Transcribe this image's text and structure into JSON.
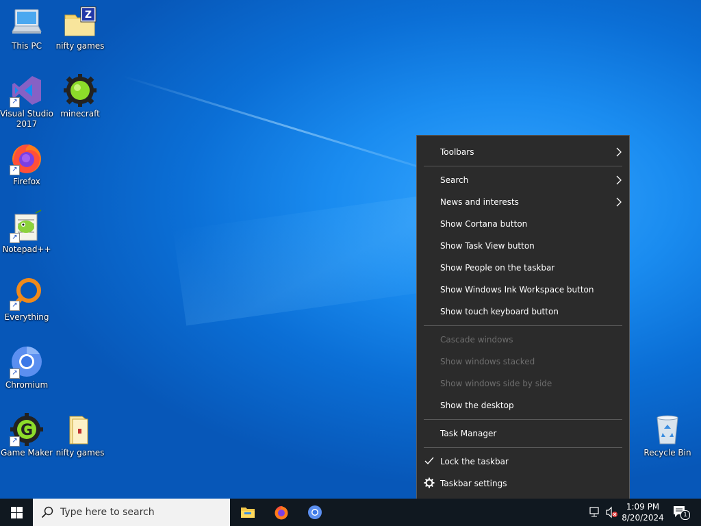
{
  "desktop": {
    "icons": [
      {
        "label": "This PC"
      },
      {
        "label": "nifty games"
      },
      {
        "label": "Visual Studio 2017"
      },
      {
        "label": "minecraft"
      },
      {
        "label": "Firefox"
      },
      {
        "label": "Notepad++"
      },
      {
        "label": "Everything"
      },
      {
        "label": "Chromium"
      },
      {
        "label": "Game Maker"
      },
      {
        "label": "nifty games"
      },
      {
        "label": "Recycle Bin"
      }
    ]
  },
  "context_menu": {
    "items": [
      {
        "label": "Toolbars",
        "submenu": true
      },
      {
        "label": "Search",
        "submenu": true
      },
      {
        "label": "News and interests",
        "submenu": true
      },
      {
        "label": "Show Cortana button"
      },
      {
        "label": "Show Task View button"
      },
      {
        "label": "Show People on the taskbar"
      },
      {
        "label": "Show Windows Ink Workspace button"
      },
      {
        "label": "Show touch keyboard button"
      },
      {
        "label": "Cascade windows",
        "disabled": true
      },
      {
        "label": "Show windows stacked",
        "disabled": true
      },
      {
        "label": "Show windows side by side",
        "disabled": true
      },
      {
        "label": "Show the desktop"
      },
      {
        "label": "Task Manager"
      },
      {
        "label": "Lock the taskbar",
        "checked": true,
        "icon": "check-icon"
      },
      {
        "label": "Taskbar settings",
        "icon": "gear-icon"
      }
    ]
  },
  "taskbar": {
    "search_placeholder": "Type here to search",
    "pinned": [
      {
        "icon": "file-explorer-icon"
      },
      {
        "icon": "firefox-icon"
      },
      {
        "icon": "chromium-icon"
      }
    ],
    "tray": {
      "network_icon": "network-icon",
      "volume_icon": "volume-muted-icon",
      "time": "1:09 PM",
      "date": "8/20/2024",
      "notification_count": "1"
    }
  },
  "colors": {
    "menu_bg": "#2b2b2b",
    "menu_separator": "#5a5a5a",
    "disabled_text": "#6d6d6d",
    "taskbar_bg": "#101820",
    "desktop_blue": "#1a8cf0"
  }
}
